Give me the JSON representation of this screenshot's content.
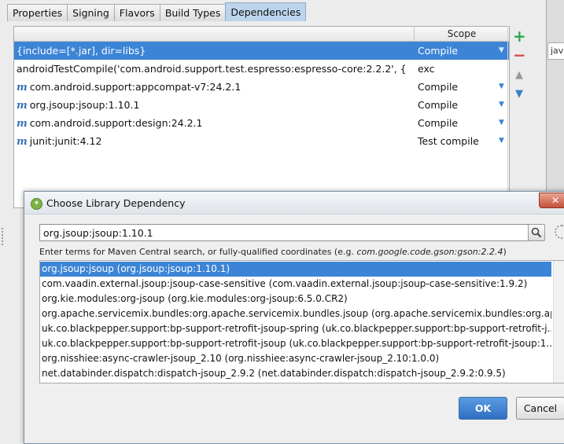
{
  "tabs": [
    {
      "label": "Properties",
      "active": false
    },
    {
      "label": "Signing",
      "active": false
    },
    {
      "label": "Flavors",
      "active": false
    },
    {
      "label": "Build Types",
      "active": false
    },
    {
      "label": "Dependencies",
      "active": true
    }
  ],
  "right_panel": {
    "java_tab_label": "java"
  },
  "dependencies": {
    "scope_header": "Scope",
    "rows": [
      {
        "name": "{include=[*.jar], dir=libs}",
        "scope": "Compile",
        "maven": false,
        "selected": true
      },
      {
        "name": "androidTestCompile('com.android.support.test.espresso:espresso-core:2.2.2', {",
        "scope": "exc",
        "maven": false,
        "selected": false
      },
      {
        "name": "com.android.support:appcompat-v7:24.2.1",
        "scope": "Compile",
        "maven": true,
        "selected": false
      },
      {
        "name": "org.jsoup:jsoup:1.10.1",
        "scope": "Compile",
        "maven": true,
        "selected": false
      },
      {
        "name": "com.android.support:design:24.2.1",
        "scope": "Compile",
        "maven": true,
        "selected": false
      },
      {
        "name": "junit:junit:4.12",
        "scope": "Test compile",
        "maven": true,
        "selected": false
      }
    ],
    "maven_glyph": "m"
  },
  "toolbar": {
    "add": "+",
    "remove": "−",
    "up": "▲",
    "down": "▼"
  },
  "dialog": {
    "title": "Choose Library Dependency",
    "close": "✕",
    "search_value": "org.jsoup:jsoup:1.10.1",
    "search_icon": "magnifier",
    "hint_prefix": "Enter terms for Maven Central search, or fully-qualified coordinates (e.g. ",
    "hint_example": "com.google.code.gson:gson:2.2.4",
    "hint_suffix": ")",
    "results": [
      "org.jsoup:jsoup (org.jsoup:jsoup:1.10.1)",
      "com.vaadin.external.jsoup:jsoup-case-sensitive (com.vaadin.external.jsoup:jsoup-case-sensitive:1.9.2)",
      "org.kie.modules:org-jsoup (org.kie.modules:org-jsoup:6.5.0.CR2)",
      "org.apache.servicemix.bundles:org.apache.servicemix.bundles.jsoup (org.apache.servicemix.bundles:org.apach...",
      "uk.co.blackpepper.support:bp-support-retrofit-jsoup-spring (uk.co.blackpepper.support:bp-support-retrofit-j...",
      "uk.co.blackpepper.support:bp-support-retrofit-jsoup (uk.co.blackpepper.support:bp-support-retrofit-jsoup:1....",
      "org.nisshiee:async-crawler-jsoup_2.10 (org.nisshiee:async-crawler-jsoup_2.10:1.0.0)",
      "net.databinder.dispatch:dispatch-jsoup_2.9.2 (net.databinder.dispatch:dispatch-jsoup_2.9.2:0.9.5)"
    ],
    "selected_result": 0,
    "ok_label": "OK",
    "cancel_label": "Cancel"
  },
  "colors": {
    "selection": "#3c84d6",
    "active_tab": "#bcd4ec",
    "add": "#2ea84a",
    "remove": "#d64a4a"
  }
}
